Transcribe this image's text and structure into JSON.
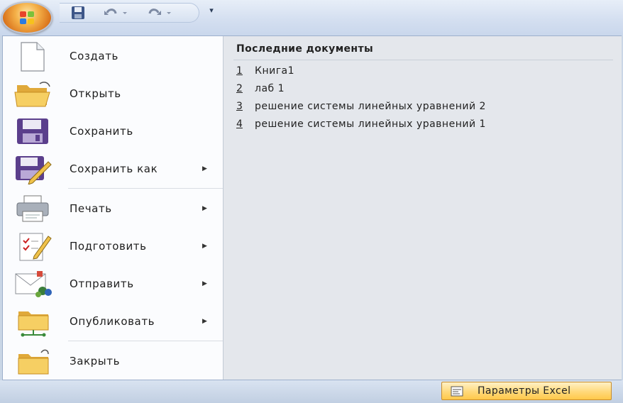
{
  "quick_access": {
    "customize_glyph": "▾",
    "icons": [
      "office-button-icon",
      "save-icon",
      "undo-icon",
      "redo-icon",
      "customize-icon"
    ]
  },
  "menu": {
    "items": [
      {
        "label": "Создать",
        "icon": "new-document-icon",
        "submenu": false
      },
      {
        "label": "Открыть",
        "icon": "open-folder-icon",
        "submenu": false
      },
      {
        "label": "Сохранить",
        "icon": "save-icon",
        "submenu": false
      },
      {
        "label": "Сохранить как",
        "icon": "save-as-icon",
        "submenu": true
      },
      {
        "label": "Печать",
        "icon": "printer-icon",
        "submenu": true
      },
      {
        "label": "Подготовить",
        "icon": "prepare-icon",
        "submenu": true
      },
      {
        "label": "Отправить",
        "icon": "send-icon",
        "submenu": true
      },
      {
        "label": "Опубликовать",
        "icon": "publish-icon",
        "submenu": true
      },
      {
        "label": "Закрыть",
        "icon": "close-folder-icon",
        "submenu": false
      }
    ],
    "submenu_arrow": "▶"
  },
  "recent": {
    "title": "Последние документы",
    "items": [
      {
        "num": "1",
        "name": "Книга1"
      },
      {
        "num": "2",
        "name": "лаб 1"
      },
      {
        "num": "3",
        "name": "решение системы линейных уравнений 2"
      },
      {
        "num": "4",
        "name": "решение системы линейных уравнений 1"
      }
    ]
  },
  "footer": {
    "options_label": "Параметры Excel",
    "options_icon": "options-icon"
  },
  "colors": {
    "accent_orange": "#e08a2a",
    "button_highlight": "#ffd97a",
    "frame_blue": "#c9d6e6"
  }
}
